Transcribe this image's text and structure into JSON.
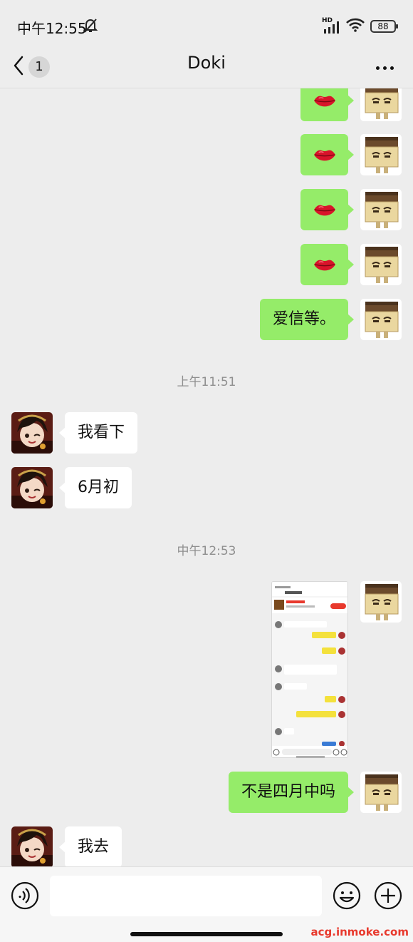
{
  "status_bar": {
    "time": "中午12:55",
    "network_label": "HD",
    "battery": "88"
  },
  "nav": {
    "unread_count": "1",
    "title": "Doki"
  },
  "icons": {
    "back": "chevron-left-icon",
    "more": "more-dots-icon",
    "mute": "bell-off-icon",
    "voice": "voice-icon",
    "emoji": "emoji-icon",
    "plus": "plus-icon",
    "lips": "lips-emoji"
  },
  "messages": {
    "text_1": "爱信等。",
    "time_1": "上午11:51",
    "text_2": "我看下",
    "text_3": "6月初",
    "time_2": "中午12:53",
    "text_4": "不是四月中吗",
    "text_5": "我去"
  },
  "input": {
    "value": ""
  },
  "watermark": "acg.inmoke.com",
  "colors": {
    "self_bubble": "#95ec69",
    "other_bubble": "#ffffff",
    "background": "#ededed"
  }
}
